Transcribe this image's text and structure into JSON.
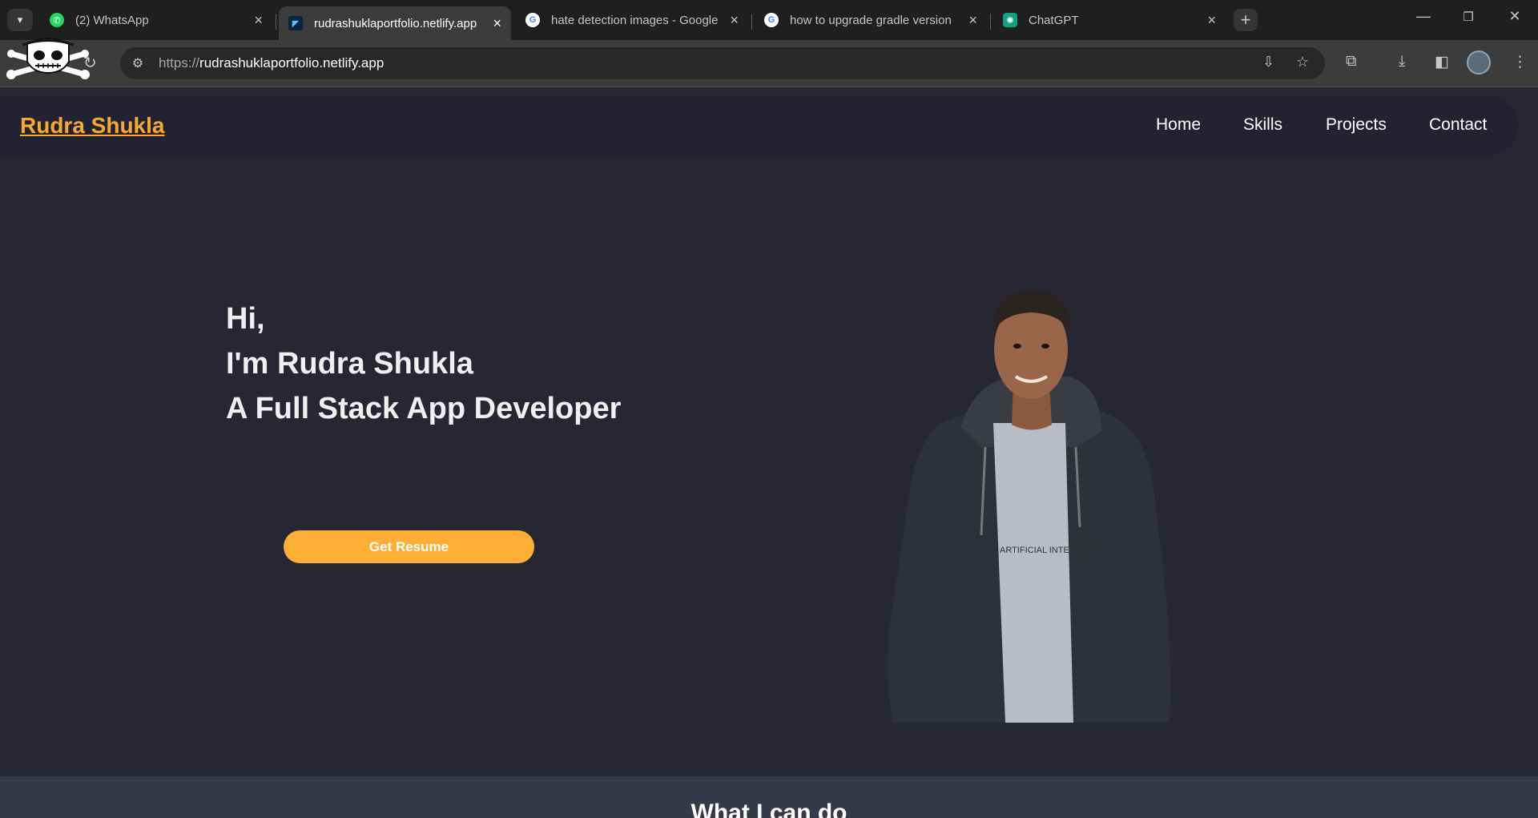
{
  "browser": {
    "tabs": [
      {
        "title": "(2) WhatsApp",
        "favicon": "whatsapp-icon",
        "active": false
      },
      {
        "title": "rudrashuklaportfolio.netlify.app",
        "favicon": "flutter-icon",
        "active": true
      },
      {
        "title": "hate detection images - Google",
        "favicon": "google-icon",
        "active": false
      },
      {
        "title": "how to upgrade gradle version",
        "favicon": "google-icon",
        "active": false
      },
      {
        "title": "ChatGPT",
        "favicon": "chatgpt-icon",
        "active": false
      }
    ],
    "url_scheme": "https://",
    "url_host": "rudrashuklaportfolio.netlify.app"
  },
  "site": {
    "brand": "Rudra Shukla",
    "nav": [
      "Home",
      "Skills",
      "Projects",
      "Contact"
    ],
    "hero": {
      "line1": "Hi,",
      "line2": "I'm Rudra Shukla",
      "line3": "A Full Stack App Developer",
      "button": "Get Resume"
    },
    "portrait_text": "ARTIFICIAL INTELEGE",
    "section_title": "What I can do"
  },
  "colors": {
    "page_bg": "#272734",
    "accent": "#fdaf35",
    "brand": "#f6a935"
  }
}
